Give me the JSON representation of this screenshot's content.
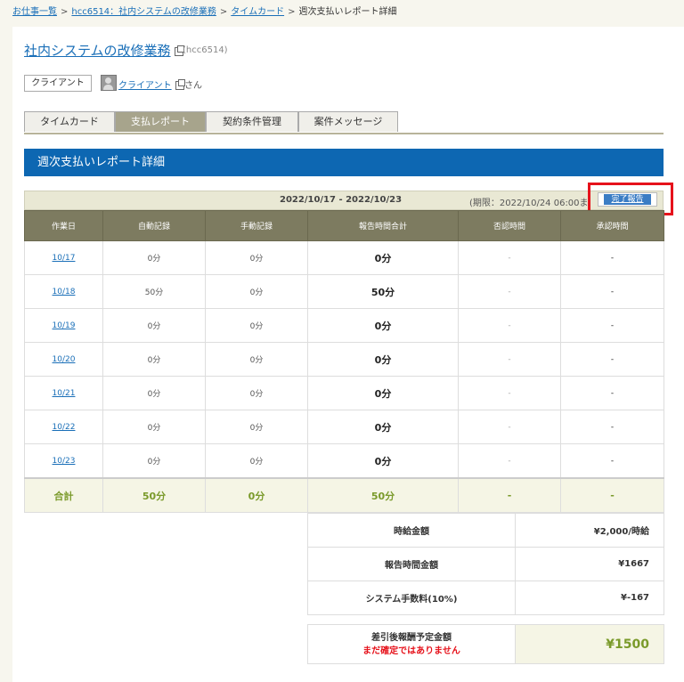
{
  "breadcrumb": {
    "items": [
      "お仕事一覧",
      "hcc6514：社内システムの改修業務",
      "タイムカード"
    ],
    "current": "週次支払いレポート詳細",
    "separator": ">"
  },
  "job": {
    "title": "社内システムの改修業務",
    "id": "(hcc6514)",
    "tag": "クライアント",
    "client_name": "クライアント",
    "client_suffix": "さん"
  },
  "tabs": [
    {
      "label": "タイムカード",
      "active": false
    },
    {
      "label": "支払レポート",
      "active": true
    },
    {
      "label": "契約条件管理",
      "active": false
    },
    {
      "label": "案件メッセージ",
      "active": false
    }
  ],
  "section_title": "週次支払いレポート詳細",
  "period": {
    "range": "2022/10/17 - 2022/10/23",
    "deadline": "(期限：2022/10/24 06:00ま",
    "complete_button": "完了報告"
  },
  "table": {
    "headers": [
      "作業日",
      "自動記録",
      "手動記録",
      "報告時間合計",
      "否認時間",
      "承認時間"
    ],
    "rows": [
      {
        "date": "10/17",
        "auto": "0分",
        "manual": "0分",
        "total": "0分",
        "denied": "-",
        "approved": "-"
      },
      {
        "date": "10/18",
        "auto": "50分",
        "manual": "0分",
        "total": "50分",
        "denied": "-",
        "approved": "-"
      },
      {
        "date": "10/19",
        "auto": "0分",
        "manual": "0分",
        "total": "0分",
        "denied": "-",
        "approved": "-"
      },
      {
        "date": "10/20",
        "auto": "0分",
        "manual": "0分",
        "total": "0分",
        "denied": "-",
        "approved": "-"
      },
      {
        "date": "10/21",
        "auto": "0分",
        "manual": "0分",
        "total": "0分",
        "denied": "-",
        "approved": "-"
      },
      {
        "date": "10/22",
        "auto": "0分",
        "manual": "0分",
        "total": "0分",
        "denied": "-",
        "approved": "-"
      },
      {
        "date": "10/23",
        "auto": "0分",
        "manual": "0分",
        "total": "0分",
        "denied": "-",
        "approved": "-"
      }
    ],
    "totals": {
      "label": "合計",
      "auto": "50分",
      "manual": "0分",
      "total": "50分",
      "denied": "-",
      "approved": "-"
    }
  },
  "summary": [
    {
      "label": "時給金額",
      "value": "¥2,000/時給"
    },
    {
      "label": "報告時間金額",
      "value": "¥1667"
    },
    {
      "label": "システム手数料(10%)",
      "value": "¥-167"
    }
  ],
  "final": {
    "label": "差引後報酬予定金額",
    "warning": "まだ確定ではありません",
    "value": "¥1500"
  },
  "colors": {
    "accent_blue": "#0d67b2",
    "table_header": "#7d7b60",
    "highlight": "#e6121b",
    "total_green": "#7a9a2a"
  }
}
